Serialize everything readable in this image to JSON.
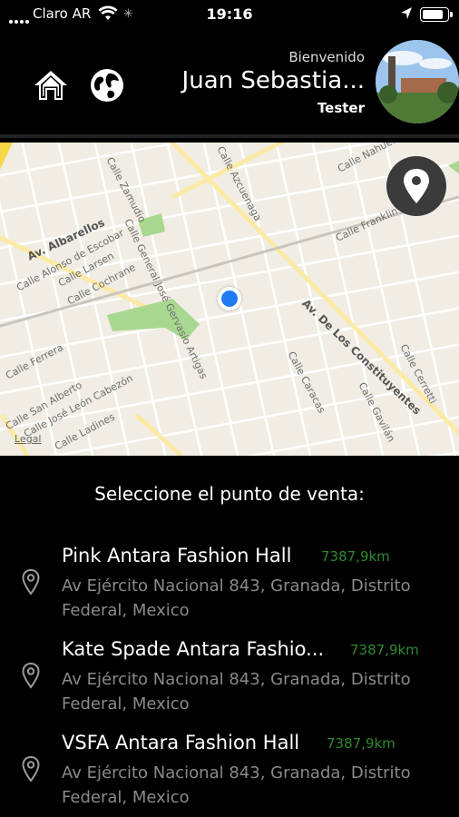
{
  "status_bar": {
    "carrier": "Claro AR",
    "time": "19:16"
  },
  "header": {
    "welcome": "Bienvenido",
    "username": "Juan Sebastia...",
    "role": "Tester"
  },
  "map": {
    "legal": "Legal",
    "streets": [
      "Av. Albarellos",
      "Calle Alonso de Escobar",
      "Calle Larsen",
      "Calle Cochrane",
      "Calle Zamudio",
      "Calle General José Gervasio Artigas",
      "Av. De Los Constituyentes",
      "Calle Franklin",
      "Calle Nahuel",
      "Calle Azcuenaga",
      "Calle Caracas",
      "Calle Gavilán",
      "Calle Cerretti",
      "Calle San Alberto",
      "Calle José León Cabezón",
      "Calle Ladines",
      "Calle Ferrera"
    ]
  },
  "prompt": "Seleccione el punto de venta:",
  "stores": [
    {
      "name": "Pink Antara Fashion Hall",
      "distance": "7387,9km",
      "address": "Av Ejército Nacional 843, Granada, Distrito Federal, Mexico"
    },
    {
      "name": "Kate Spade Antara Fashio...",
      "distance": "7387,9km",
      "address": "Av Ejército Nacional 843, Granada, Distrito Federal, Mexico"
    },
    {
      "name": "VSFA Antara Fashion Hall",
      "distance": "7387,9km",
      "address": "Av Ejército Nacional 843, Granada, Distrito Federal, Mexico"
    }
  ]
}
